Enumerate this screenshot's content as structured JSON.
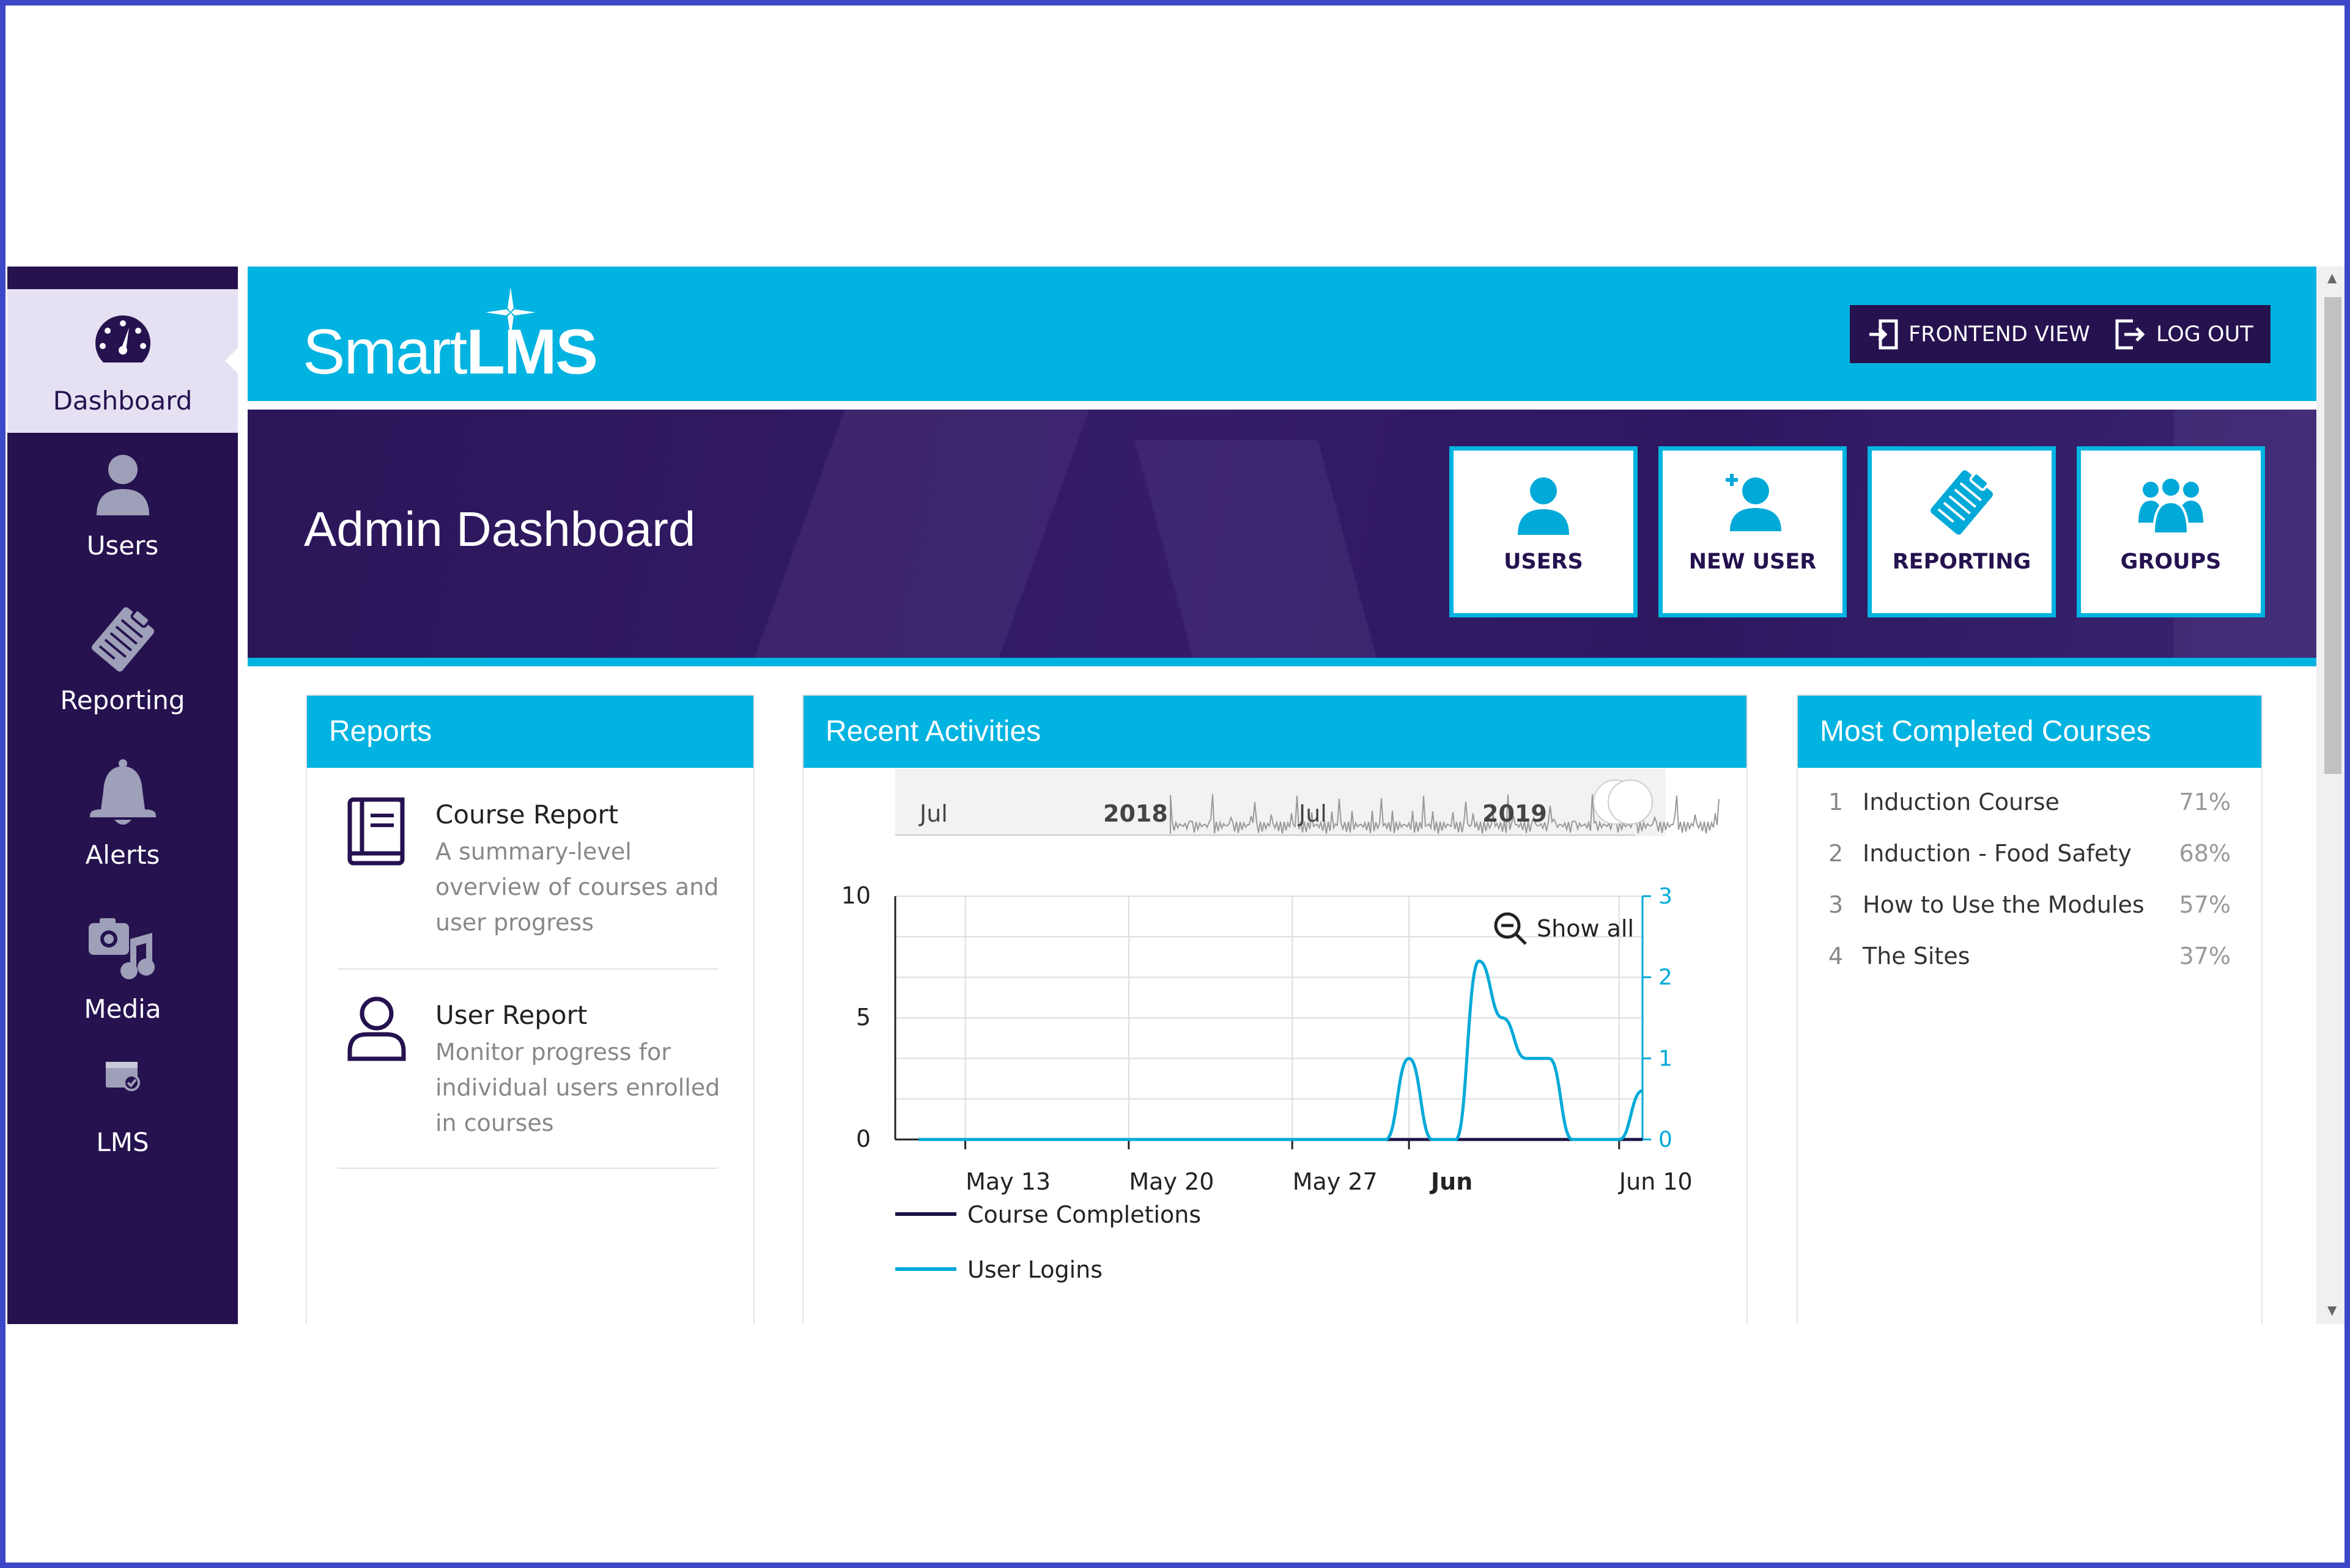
{
  "sidebar": {
    "items": [
      {
        "label": "Dashboard",
        "icon": "dashboard-gauge-icon"
      },
      {
        "label": "Users",
        "icon": "user-icon"
      },
      {
        "label": "Reporting",
        "icon": "clipboard-icon"
      },
      {
        "label": "Alerts",
        "icon": "bell-icon"
      },
      {
        "label": "Media",
        "icon": "media-icon"
      },
      {
        "label": "LMS",
        "icon": "lms-icon"
      }
    ]
  },
  "header": {
    "logo_light": "Smart",
    "logo_bold": "LMS",
    "frontend_view": "FRONTEND VIEW",
    "log_out": "LOG OUT"
  },
  "banner": {
    "title": "Admin Dashboard",
    "tiles": [
      {
        "label": "USERS",
        "icon": "user-icon"
      },
      {
        "label": "NEW USER",
        "icon": "add-user-icon"
      },
      {
        "label": "REPORTING",
        "icon": "clipboard-icon"
      },
      {
        "label": "GROUPS",
        "icon": "group-icon"
      }
    ]
  },
  "reports": {
    "title": "Reports",
    "items": [
      {
        "title": "Course Report",
        "desc": "A summary-level overview of courses and user progress",
        "icon": "book-icon"
      },
      {
        "title": "User Report",
        "desc": "Monitor progress for individual users enrolled in courses",
        "icon": "person-outline-icon"
      }
    ]
  },
  "activities": {
    "title": "Recent Activities",
    "show_all": "Show all"
  },
  "chart_data": {
    "type": "line",
    "x_ticks": [
      "May 13",
      "May 20",
      "May 27",
      "Jun",
      "Jun 10"
    ],
    "navigator_labels": [
      "Jul",
      "2018",
      "Jul",
      "2019"
    ],
    "y_left": {
      "ticks": [
        0,
        5,
        10
      ],
      "ylim": [
        0,
        10
      ]
    },
    "y_right": {
      "ticks": [
        0,
        1,
        2,
        3
      ],
      "ylim": [
        0,
        3
      ]
    },
    "series": [
      {
        "name": "Course Completions",
        "color": "#1b1446",
        "axis": "left",
        "x": [
          "May 11",
          "May 18",
          "May 25",
          "Jun 1",
          "Jun 8",
          "Jun 11"
        ],
        "values": [
          0,
          0,
          0,
          0,
          0,
          0
        ]
      },
      {
        "name": "User Logins",
        "color": "#00a9d8",
        "axis": "right",
        "x": [
          "May 11",
          "May 31",
          "Jun 1",
          "Jun 2",
          "Jun 3",
          "Jun 4",
          "Jun 5",
          "Jun 6",
          "Jun 7",
          "Jun 8",
          "Jun 9",
          "Jun 10",
          "Jun 11"
        ],
        "values": [
          0,
          0,
          1,
          0,
          0,
          2.2,
          1.5,
          1.0,
          1.0,
          0,
          0,
          0,
          0.6
        ]
      }
    ],
    "grid": true,
    "legend": "bottom"
  },
  "courses": {
    "title": "Most Completed Courses",
    "items": [
      {
        "rank": "1",
        "name": "Induction Course",
        "pct": "71%"
      },
      {
        "rank": "2",
        "name": "Induction - Food Safety",
        "pct": "68%"
      },
      {
        "rank": "3",
        "name": "How to Use the Modules",
        "pct": "57%"
      },
      {
        "rank": "4",
        "name": "The Sites",
        "pct": "37%"
      }
    ]
  }
}
